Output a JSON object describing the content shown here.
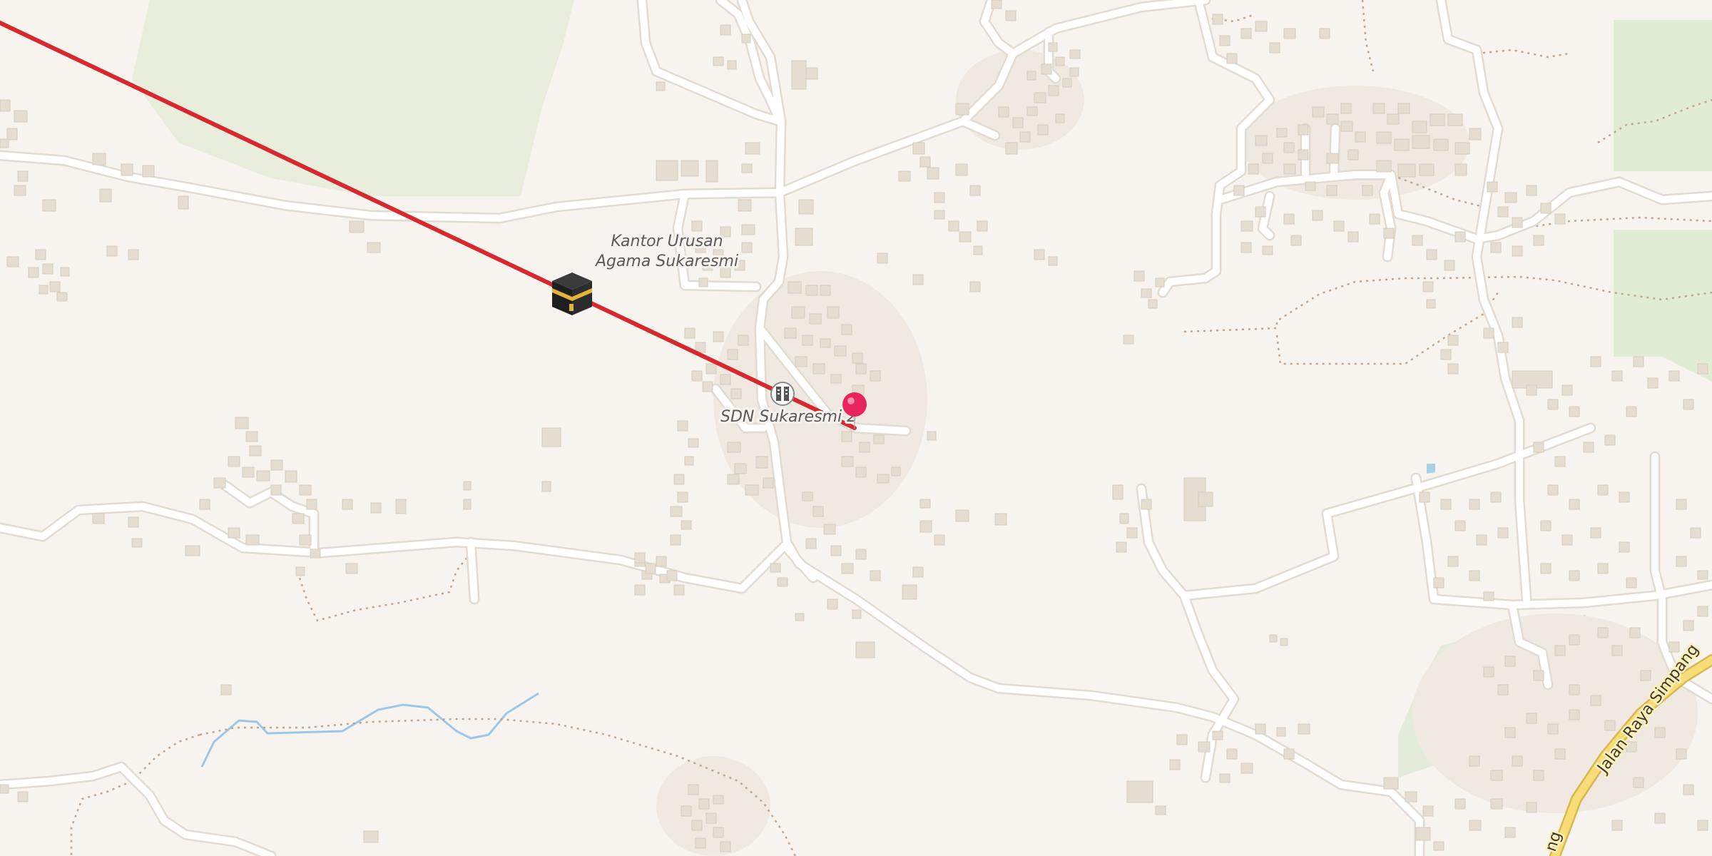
{
  "map": {
    "labels": {
      "kua_line1": "Kantor Urusan",
      "kua_line2": "Agama Sukaresmi",
      "school": "SDN Sukaresmi 2",
      "road": "Jalan Raya Simpang",
      "road_fragment": "ng"
    },
    "markers": {
      "destination_icon": "kaaba-icon",
      "location_icon": "map-pin-icon",
      "school_icon": "school-icon"
    },
    "colors": {
      "background": "#f7f4f0",
      "road": "#ffffff",
      "primary_road": "#f6d870",
      "forest": "#e6eedd",
      "water": "#a8cfe8",
      "qibla_line": "#d8282e",
      "pin": "#e8245c"
    }
  }
}
